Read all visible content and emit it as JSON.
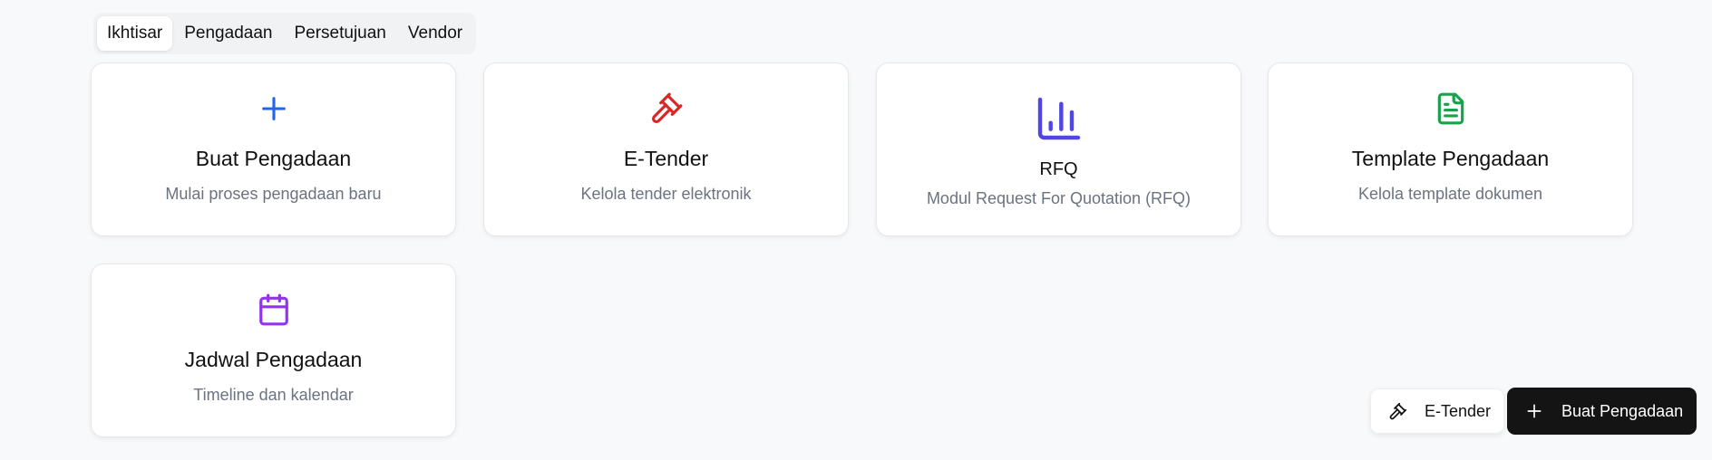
{
  "tabs": [
    {
      "label": "Ikhtisar",
      "active": true
    },
    {
      "label": "Pengadaan",
      "active": false
    },
    {
      "label": "Persetujuan",
      "active": false
    },
    {
      "label": "Vendor",
      "active": false
    }
  ],
  "cards": [
    {
      "icon": "plus-icon",
      "color": "#2563eb",
      "title": "Buat Pengadaan",
      "description": "Mulai proses pengadaan baru"
    },
    {
      "icon": "gavel-icon",
      "color": "#dc2626",
      "title": "E-Tender",
      "description": "Kelola tender elektronik"
    },
    {
      "icon": "bar-chart-icon",
      "color": "#4f46e5",
      "title": "RFQ",
      "description": "Modul Request For Quotation (RFQ)"
    },
    {
      "icon": "file-text-icon",
      "color": "#16a34a",
      "title": "Template Pengadaan",
      "description": "Kelola template dokumen"
    },
    {
      "icon": "calendar-icon",
      "color": "#9333ea",
      "title": "Jadwal Pengadaan",
      "description": "Timeline dan kalendar"
    }
  ],
  "actions": {
    "etender_label": "E-Tender",
    "etender_icon": "gavel-icon",
    "create_label": "Buat Pengadaan",
    "create_icon": "plus-icon"
  }
}
